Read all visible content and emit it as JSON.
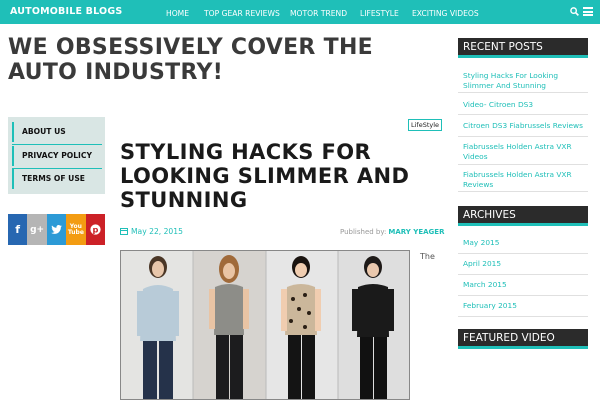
{
  "topbar": {
    "brand": "AUTOMOBILE BLOGS",
    "nav": [
      "HOME",
      "TOP GEAR REVIEWS",
      "MOTOR TREND",
      "LIFESTYLE",
      "EXCITING VIDEOS"
    ],
    "icons": [
      "search-icon",
      "menu-icon"
    ],
    "bg_color": "#1fbfb8"
  },
  "headline": "WE OBSESSIVELY COVER THE AUTO INDUSTRY!",
  "left_menu": [
    "ABOUT US",
    "PRIVACY POLICY",
    "TERMS OF USE"
  ],
  "social": [
    {
      "icon": "facebook-icon",
      "glyph": "f",
      "color": "#2767b1"
    },
    {
      "icon": "googleplus-icon",
      "glyph": "g+",
      "color": "#b5b5b5"
    },
    {
      "icon": "twitter-icon",
      "glyph": "t",
      "color": "#2c9ad6"
    },
    {
      "icon": "youtube-icon",
      "glyph": "You\nTube",
      "color": "#f39c12"
    },
    {
      "icon": "pinterest-icon",
      "glyph": "p",
      "color": "#cc2127"
    }
  ],
  "article": {
    "tag": "LifeStyle",
    "title": "STYLING HACKS FOR LOOKING SLIMMER AND STUNNING",
    "date": "May 22, 2015",
    "published_by_label": "Published by:",
    "author": "MARY YEAGER",
    "body_start": "The"
  },
  "sidebar": {
    "recent_posts_title": "RECENT POSTS",
    "recent_posts": [
      "Styling Hacks For Looking Slimmer And Stunning",
      "Video- Citroen DS3",
      "Citroen DS3 Fiabrussels Reviews",
      "Fiabrussels Holden Astra VXR Videos",
      "Fiabrussels Holden Astra VXR Reviews"
    ],
    "archives_title": "ARCHIVES",
    "archives": [
      "May 2015",
      "April 2015",
      "March 2015",
      "February 2015"
    ],
    "featured_video_title": "FEATURED VIDEO"
  }
}
